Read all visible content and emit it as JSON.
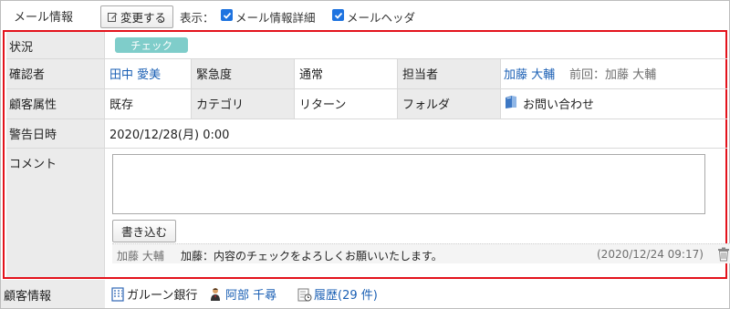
{
  "toolbar": {
    "title": "メール情報",
    "edit_label": "変更する",
    "display_label": "表示：",
    "check1_label": "メール情報詳細",
    "check2_label": "メールヘッダ"
  },
  "status": {
    "label": "状況",
    "badge": "チェック",
    "badge_color": "#7fcdca"
  },
  "confirm": {
    "label": "確認者",
    "user": "田中 愛美",
    "urgency_label": "緊急度",
    "urgency_value": "通常",
    "assignee_label": "担当者",
    "assignee": "加藤 大輔",
    "previous": "前回：加藤 大輔"
  },
  "attributes": {
    "label": "顧客属性",
    "value": "既存",
    "category_label": "カテゴリ",
    "category_value": "リターン",
    "folder_label": "フォルダ",
    "folder_value": "お問い合わせ"
  },
  "warning": {
    "label": "警告日時",
    "value": "2020/12/28(月) 0:00"
  },
  "comment": {
    "label": "コメント",
    "textarea_value": "",
    "write_label": "書き込む",
    "entries": [
      {
        "author": "加藤 大輔",
        "text": "加藤：内容のチェックをよろしくお願いいたします。",
        "date": "(2020/12/24 09:17)"
      }
    ]
  },
  "customer": {
    "label": "顧客情報",
    "company": "ガルーン銀行",
    "person": "阿部 千尋",
    "history": "履歴(29 件)"
  },
  "colors": {
    "accent_red": "#e3121b",
    "link": "#1a5fb4",
    "checkbox": "#1e73e0"
  }
}
